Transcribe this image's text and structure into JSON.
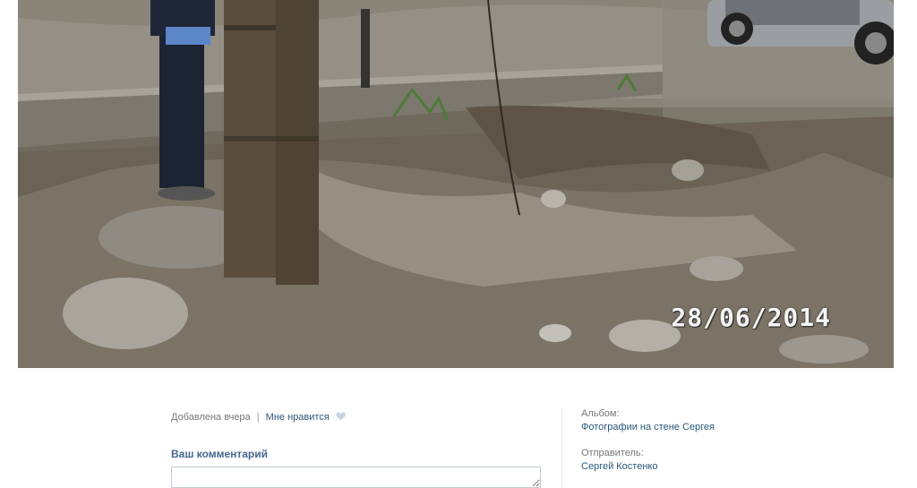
{
  "photo": {
    "alt": "Фотография",
    "date_stamp": "28/06/2014"
  },
  "meta": {
    "added": "Добавлена вчера",
    "separator": "|",
    "like_label": "Мне нравится",
    "heart_icon": "heart-icon"
  },
  "comment": {
    "title": "Ваш комментарий",
    "placeholder": ""
  },
  "sidebar": {
    "album_label": "Альбом:",
    "album_value": "Фотографии на стене Сергея",
    "sender_label": "Отправитель:",
    "sender_value": "Сергей Костенко"
  },
  "colors": {
    "link": "#2b587a",
    "title": "#45688e",
    "muted": "#777777"
  }
}
